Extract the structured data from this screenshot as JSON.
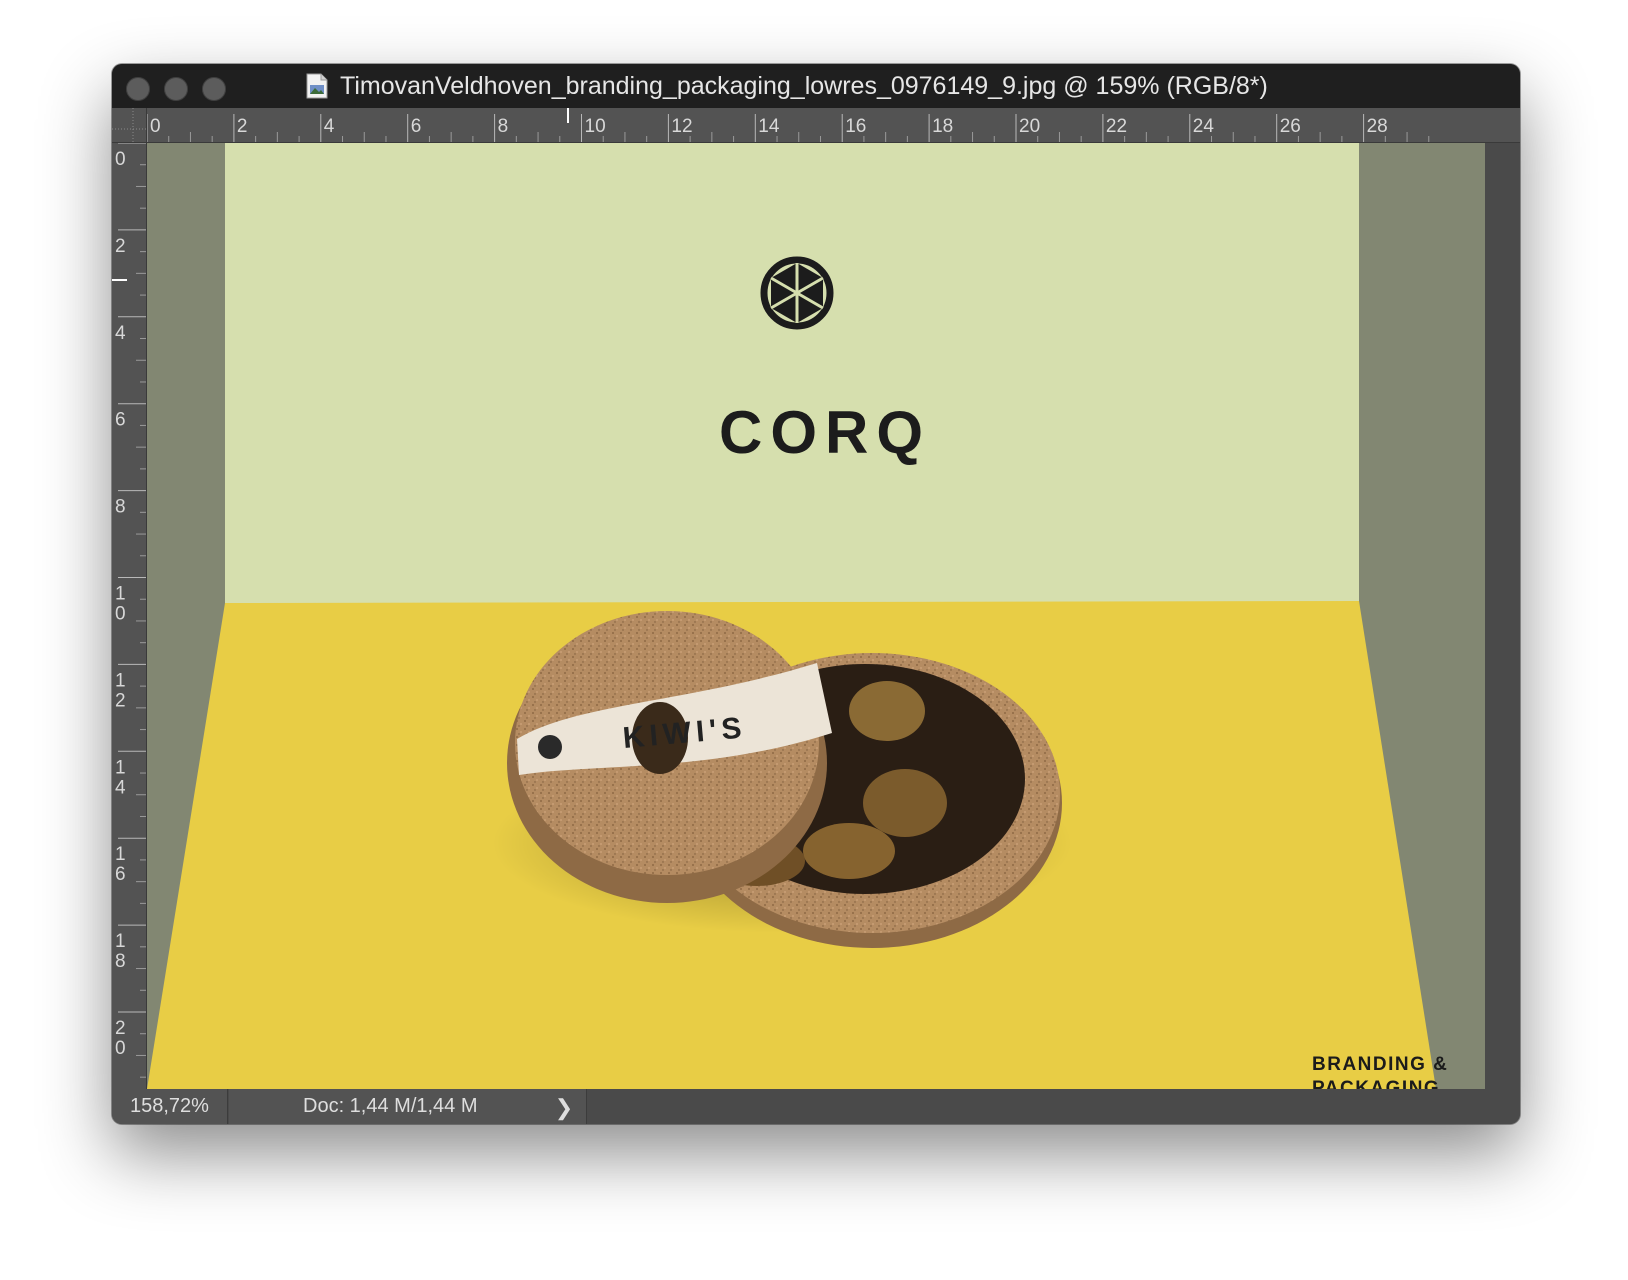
{
  "window": {
    "title": "TimovanVeldhoven_branding_packaging_lowres_0976149_9.jpg @ 159% (RGB/8*)",
    "title_icon": "jpeg-document-icon",
    "traffic_lights": [
      "close-button",
      "minimize-button",
      "zoom-button"
    ]
  },
  "rulers": {
    "horizontal_labels": [
      "0",
      "2",
      "4",
      "6",
      "8",
      "10",
      "12",
      "14",
      "16",
      "18",
      "20",
      "22",
      "24",
      "26",
      "28"
    ],
    "vertical_labels": [
      "0",
      "2",
      "4",
      "6",
      "8",
      "10",
      "12",
      "14",
      "16",
      "18",
      "20"
    ]
  },
  "artwork": {
    "logo_word": "CORQ",
    "logo_icon": "corq-hexagon-logo-icon",
    "product_label": "KIWI'S",
    "tagline_line1": "BRANDING &",
    "tagline_line2": "PACKAGING",
    "colors": {
      "wall": "#d6dfae",
      "floor": "#e8cd45",
      "side_walls": "#828772",
      "cork": "#b58c62",
      "logo": "#1c1c1c"
    }
  },
  "status": {
    "zoom": "158,72%",
    "doc_info": "Doc: 1,44 M/1,44 M",
    "arrow": "❯"
  }
}
